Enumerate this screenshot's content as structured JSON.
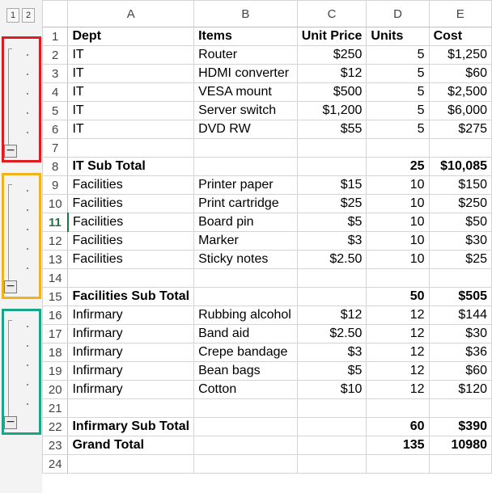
{
  "outline": {
    "levels": [
      "1",
      "2"
    ],
    "collapse_symbol": "−",
    "groups": [
      {
        "color": "#e11b22"
      },
      {
        "color": "#f2b21a"
      },
      {
        "color": "#1aa489"
      }
    ]
  },
  "columns": [
    "A",
    "B",
    "C",
    "D",
    "E"
  ],
  "active_row": "11",
  "rows": [
    {
      "num": "1",
      "style": "header",
      "cells": [
        "Dept",
        "Items",
        "Unit Price",
        "Units",
        "Cost"
      ]
    },
    {
      "num": "2",
      "style": "",
      "cells": [
        "IT",
        "Router",
        "$250",
        "5",
        "$1,250"
      ]
    },
    {
      "num": "3",
      "style": "",
      "cells": [
        "IT",
        "HDMI converter",
        "$12",
        "5",
        "$60"
      ]
    },
    {
      "num": "4",
      "style": "",
      "cells": [
        "IT",
        "VESA mount",
        "$500",
        "5",
        "$2,500"
      ]
    },
    {
      "num": "5",
      "style": "",
      "cells": [
        "IT",
        "Server switch",
        "$1,200",
        "5",
        "$6,000"
      ]
    },
    {
      "num": "6",
      "style": "",
      "cells": [
        "IT",
        "DVD RW",
        "$55",
        "5",
        "$275"
      ]
    },
    {
      "num": "7",
      "style": "",
      "cells": [
        "",
        "",
        "",
        "",
        ""
      ]
    },
    {
      "num": "8",
      "style": "bold",
      "cells": [
        "IT Sub Total",
        "",
        "",
        "25",
        "$10,085"
      ]
    },
    {
      "num": "9",
      "style": "",
      "cells": [
        "Facilities",
        "Printer paper",
        "$15",
        "10",
        "$150"
      ]
    },
    {
      "num": "10",
      "style": "",
      "cells": [
        "Facilities",
        "Print cartridge",
        "$25",
        "10",
        "$250"
      ]
    },
    {
      "num": "11",
      "style": "",
      "cells": [
        "Facilities",
        "Board pin",
        "$5",
        "10",
        "$50"
      ]
    },
    {
      "num": "12",
      "style": "",
      "cells": [
        "Facilities",
        "Marker",
        "$3",
        "10",
        "$30"
      ]
    },
    {
      "num": "13",
      "style": "",
      "cells": [
        "Facilities",
        "Sticky notes",
        "$2.50",
        "10",
        "$25"
      ]
    },
    {
      "num": "14",
      "style": "",
      "cells": [
        "",
        "",
        "",
        "",
        ""
      ]
    },
    {
      "num": "15",
      "style": "bold",
      "cells": [
        "Facilities Sub Total",
        "",
        "",
        "50",
        "$505"
      ]
    },
    {
      "num": "16",
      "style": "",
      "cells": [
        "Infirmary",
        "Rubbing alcohol",
        "$12",
        "12",
        "$144"
      ]
    },
    {
      "num": "17",
      "style": "",
      "cells": [
        "Infirmary",
        "Band aid",
        "$2.50",
        "12",
        "$30"
      ]
    },
    {
      "num": "18",
      "style": "",
      "cells": [
        "Infirmary",
        "Crepe bandage",
        "$3",
        "12",
        "$36"
      ]
    },
    {
      "num": "19",
      "style": "",
      "cells": [
        "Infirmary",
        "Bean bags",
        "$5",
        "12",
        "$60"
      ]
    },
    {
      "num": "20",
      "style": "",
      "cells": [
        "Infirmary",
        "Cotton",
        "$10",
        "12",
        "$120"
      ]
    },
    {
      "num": "21",
      "style": "",
      "cells": [
        "",
        "",
        "",
        "",
        ""
      ]
    },
    {
      "num": "22",
      "style": "bold",
      "cells": [
        "Infirmary Sub Total",
        "",
        "",
        "60",
        "$390"
      ]
    },
    {
      "num": "23",
      "style": "bold",
      "cells": [
        "Grand Total",
        "",
        "",
        "135",
        "10980"
      ]
    },
    {
      "num": "24",
      "style": "",
      "cells": [
        "",
        "",
        "",
        "",
        ""
      ]
    }
  ]
}
